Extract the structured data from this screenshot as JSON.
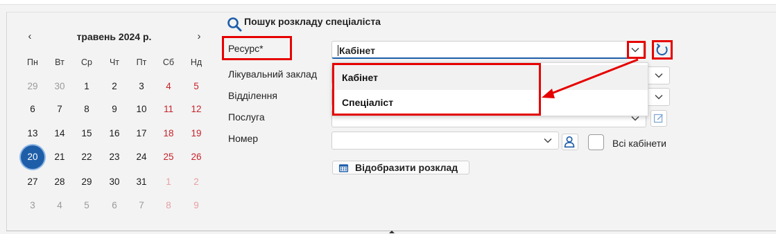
{
  "calendar": {
    "month_title": "травень 2024 р.",
    "prev_arrow": "‹",
    "next_arrow": "›",
    "weekdays": [
      "Пн",
      "Вт",
      "Ср",
      "Чт",
      "Пт",
      "Сб",
      "Нд"
    ],
    "weeks": [
      [
        "29",
        "30",
        "1",
        "2",
        "3",
        "4",
        "5"
      ],
      [
        "6",
        "7",
        "8",
        "9",
        "10",
        "11",
        "12"
      ],
      [
        "13",
        "14",
        "15",
        "16",
        "17",
        "18",
        "19"
      ],
      [
        "20",
        "21",
        "22",
        "23",
        "24",
        "25",
        "26"
      ],
      [
        "27",
        "28",
        "29",
        "30",
        "31",
        "1",
        "2"
      ],
      [
        "3",
        "4",
        "5",
        "6",
        "7",
        "8",
        "9"
      ]
    ],
    "selected_day": "20"
  },
  "form": {
    "title": "Пошук розкладу спеціаліста",
    "labels": {
      "resource": "Ресурс*",
      "facility": "Лікувальний заклад",
      "department": "Відділення",
      "service": "Послуга",
      "number": "Номер"
    },
    "resource_value": "Кабінет",
    "all_rooms_label": "Всі кабінети",
    "show_schedule_button": "Відобразити розклад"
  },
  "dropdown": {
    "options": [
      "Кабінет",
      "Спеціаліст"
    ]
  },
  "colors": {
    "accent": "#1e5ea8",
    "weekend": "#c6232b",
    "highlight": "#e60000"
  },
  "icons": {
    "search": "search-icon",
    "refresh": "refresh-icon",
    "user": "user-icon",
    "edit": "edit-icon",
    "calendar": "calendar-icon"
  }
}
